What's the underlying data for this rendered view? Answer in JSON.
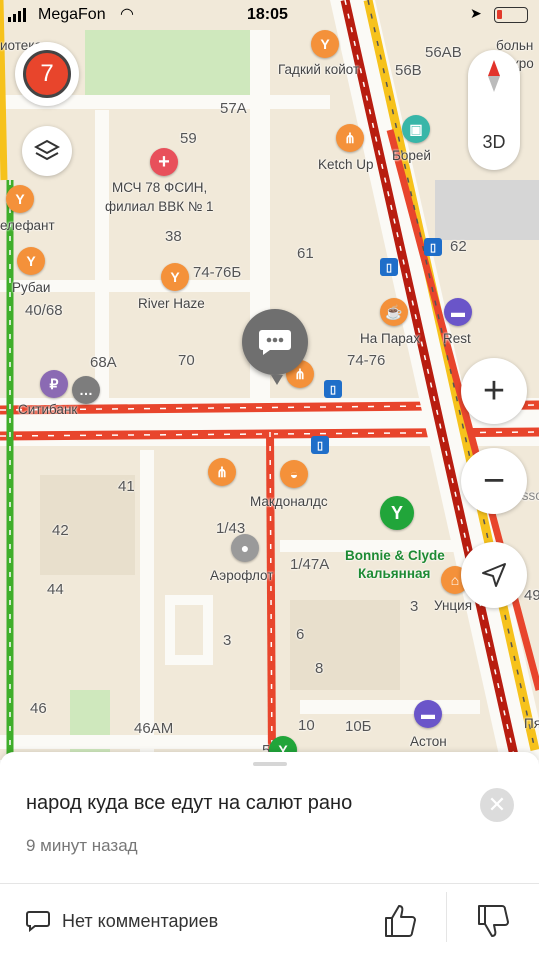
{
  "status_bar": {
    "carrier": "MegaFon",
    "time": "18:05"
  },
  "map_controls": {
    "traffic_level": "7",
    "view_3d": "3D"
  },
  "map_labels": {
    "house_numbers": [
      "56АВ",
      "56В",
      "57А",
      "59",
      "38",
      "61",
      "62",
      "40/68",
      "70",
      "74-76",
      "68А",
      "41",
      "42",
      "1/43",
      "1/47А",
      "44",
      "3",
      "6",
      "8",
      "46",
      "46АМ",
      "10",
      "10Б",
      "5",
      "3",
      "49"
    ],
    "places": [
      "Гадкий койот",
      "Борей",
      "Ketch Up",
      "МСЧ 78 ФСИН,",
      "филиал ВВК № 1",
      "74-76Б",
      "River Haze",
      "елефант",
      "Рубаи",
      "На Парах",
      "Rest",
      "Ситибанк",
      "Макдоналдс",
      "Аэрофлот",
      "Bonnie & Clyde",
      "Кальянная",
      "Унция",
      "Астон",
      "Radisson",
      "больн",
      "микро",
      "иотека",
      "Пя"
    ]
  },
  "post": {
    "text": "народ куда все едут на салют рано",
    "time_ago": "9 минут назад",
    "comments_label": "Нет комментариев"
  },
  "colors": {
    "traffic_red": "#e8452c",
    "traffic_dark": "#b81d10",
    "traffic_yellow": "#f6c21c",
    "traffic_green": "#3fae2a",
    "poi_orange": "#f4913a",
    "poi_green": "#21a53a"
  }
}
